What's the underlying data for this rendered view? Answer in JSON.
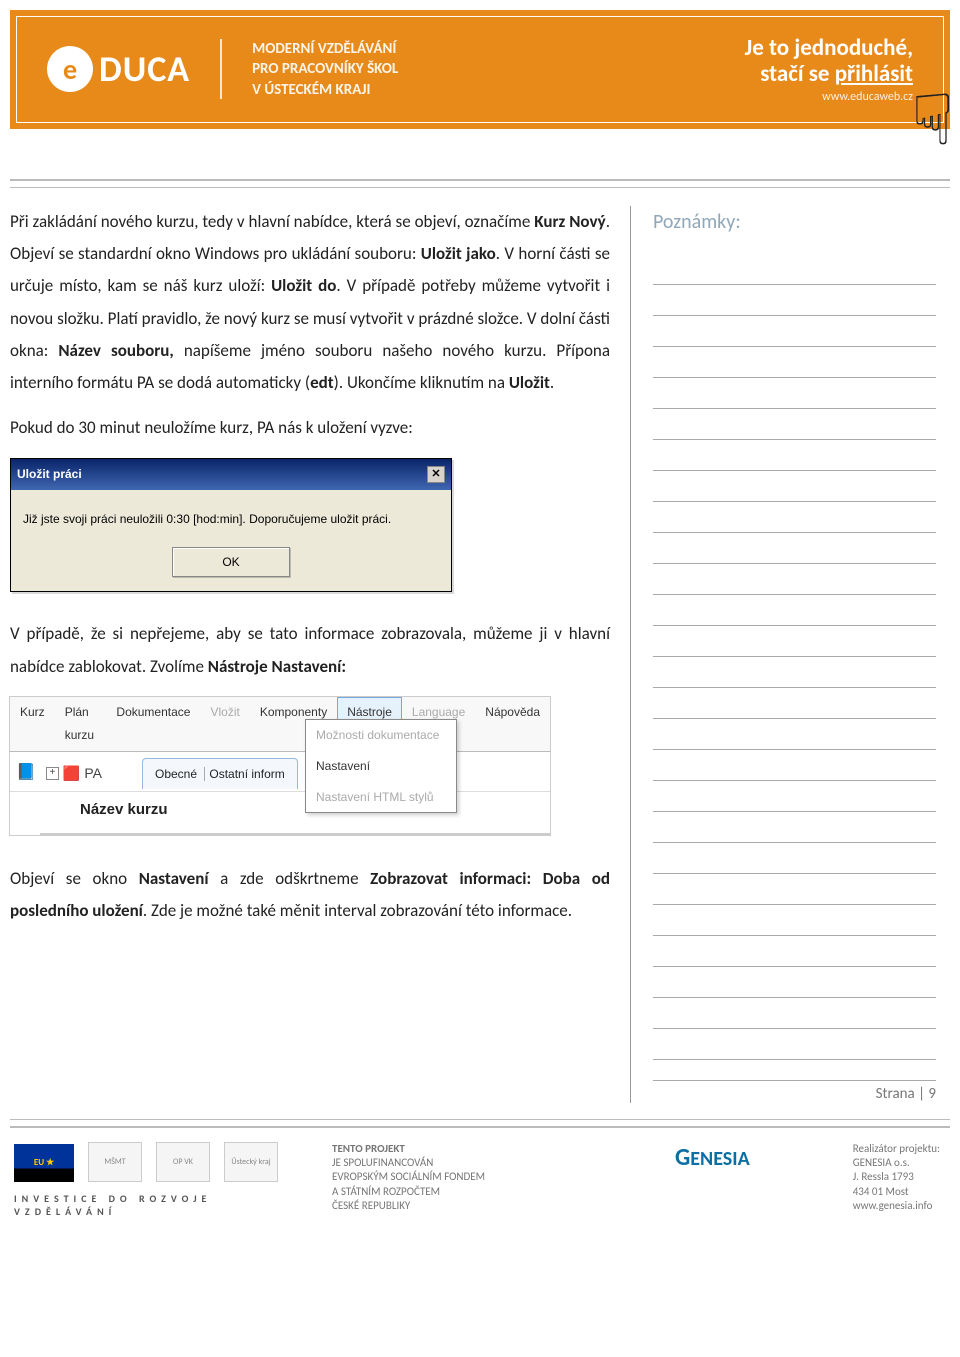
{
  "header": {
    "logo": "DUCA",
    "subtitle_line1": "MODERNÍ VZDĚLÁVÁNÍ",
    "subtitle_line2": "PRO PRACOVNÍKY ŠKOL",
    "subtitle_line3": "V ÚSTECKÉM KRAJI",
    "slogan_line1": "Je to jednoduché,",
    "slogan_line2_a": "stačí se ",
    "slogan_line2_b": "přihlásit",
    "url": "www.educaweb.cz"
  },
  "body": {
    "p1_a": "Při zakládání nového kurzu, tedy v hlavní nabídce, která se objeví, označíme ",
    "p1_b": "Kurz Nový",
    "p1_c": ". Objeví se standardní okno Windows pro ukládání souboru: ",
    "p1_d": "Uložit jako",
    "p1_e": ". V horní části se určuje místo, kam se náš kurz uloží: ",
    "p1_f": "Uložit do",
    "p1_g": ". V případě potřeby můžeme vytvořit i novou složku. Platí pravidlo, že nový kurz se musí vytvořit v prázdné složce. V dolní části okna: ",
    "p1_h": "Název souboru,",
    "p1_i": " napíšeme jméno souboru našeho nového kurzu. Přípona interního formátu PA se dodá automaticky (",
    "p1_j": "edt",
    "p1_k": "). Ukončíme kliknutím na ",
    "p1_l": "Uložit",
    "p1_m": ".",
    "p2": "Pokud do 30 minut neuložíme kurz, PA nás k uložení vyzve:",
    "p3_a": "V případě, že si nepřejeme, aby se tato informace zobrazovala, můžeme ji v hlavní nabídce zablokovat. Zvolíme ",
    "p3_b": "Nástroje ",
    "p3_c": " Nastavení:",
    "p4_a": "Objeví se okno ",
    "p4_b": "Nastavení",
    "p4_c": " a zde odškrtneme ",
    "p4_d": "Zobrazovat informaci: Doba od posledního uložení",
    "p4_e": ". Zde je možné také měnit interval zobrazování této informace."
  },
  "dialog": {
    "title": "Uložit práci",
    "message": "Již jste svoji práci neuložili 0:30 [hod:min]. Doporučujeme uložit práci.",
    "ok": "OK"
  },
  "menu": {
    "items": [
      "Kurz",
      "Plán kurzu",
      "Dokumentace",
      "Vložit",
      "Komponenty",
      "Nástroje",
      "Language",
      "Nápověda"
    ],
    "dropdown": [
      "Možnosti dokumentace",
      "Nastavení",
      "Nastavení HTML stylů"
    ],
    "tree_label": "PA",
    "tab1": "Obecné",
    "tab2": "Ostatní inform",
    "course_title": "Název kurzu"
  },
  "notes": {
    "title": "Poznámky:",
    "lines": 26
  },
  "page": {
    "label": "Strana | 9"
  },
  "footer": {
    "invest": "INVESTICE DO ROZVOJE VZDĚLÁVÁNÍ",
    "mid": [
      "TENTO PROJEKT",
      "JE SPOLUFINANCOVÁN",
      "EVROPSKÝM SOCIÁLNÍM FONDEM",
      "A STÁTNÍM ROZPOČTEM",
      "ČESKÉ REPUBLIKY"
    ],
    "genesia": "ENESIA",
    "right_title": "Realizátor projektu:",
    "right_lines": [
      "GENESIA o.s.",
      "J. Ressla 1793",
      "434 01 Most",
      "www.genesia.info"
    ],
    "logos": [
      "EU ★",
      "MŠMT",
      "OP VK",
      "Ústecký kraj"
    ]
  }
}
